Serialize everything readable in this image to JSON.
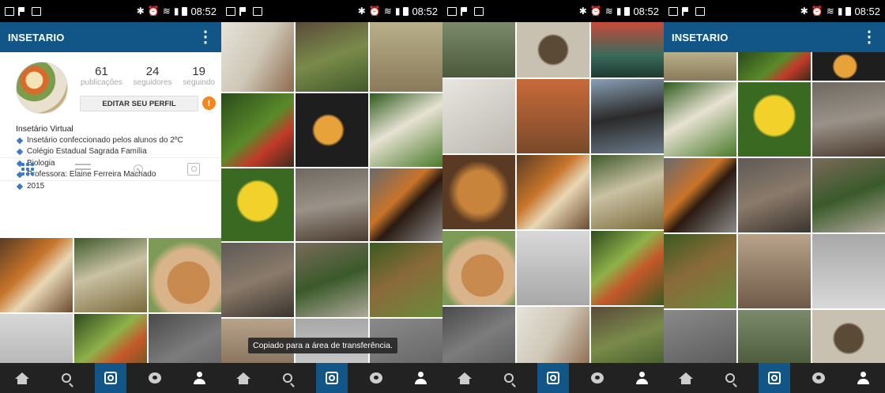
{
  "status_bar": {
    "time": "08:52"
  },
  "app_bar": {
    "title": "INSETARIO",
    "menu_icon": "overflow-menu-icon"
  },
  "profile": {
    "stats": [
      {
        "count": "61",
        "label": "publicações"
      },
      {
        "count": "24",
        "label": "seguidores"
      },
      {
        "count": "19",
        "label": "seguindo"
      }
    ],
    "edit_button_label": "EDITAR SEU PERFIL",
    "warning_badge": "!",
    "bio_name": "Insetário Virtual",
    "bio_lines": [
      "Insetário confeccionado pelos alunos do 2ºC",
      "Colégio Estadual Sagrada Família",
      "Biologia",
      "Professora: Elaine Ferreira Machado",
      "2015"
    ]
  },
  "profile_tabs": [
    "grid-icon",
    "list-icon",
    "location-pin-icon",
    "tagged-photos-icon"
  ],
  "toast": "Copiado para a área de transferência.",
  "bottom_nav": [
    {
      "icon": "home-icon",
      "active": false
    },
    {
      "icon": "search-icon",
      "active": false
    },
    {
      "icon": "camera-icon",
      "active": true
    },
    {
      "icon": "activity-bubble-icon",
      "active": false
    },
    {
      "icon": "profile-icon",
      "active": false
    }
  ],
  "colors": {
    "app_bar": "#125688",
    "accent_blue": "#3a7bc8",
    "warning_orange": "#f5851f",
    "nav_bar": "#222222"
  }
}
